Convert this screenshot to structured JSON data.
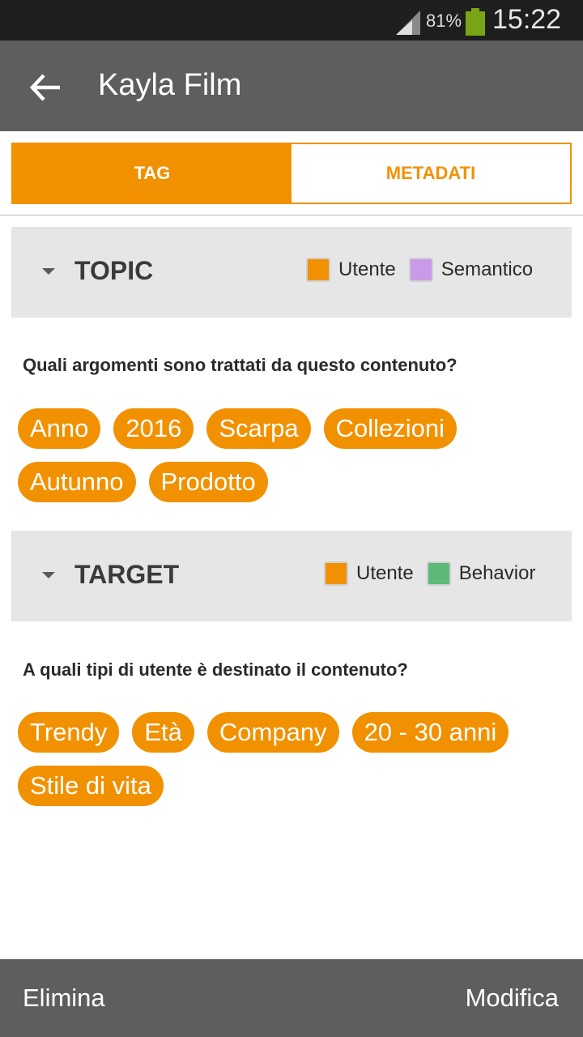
{
  "status_bar": {
    "battery_percent": "81%",
    "battery_level": 0.81,
    "time": "15:22",
    "signal_icon": "signal-icon",
    "battery_icon": "battery-icon"
  },
  "app_bar": {
    "title": "Kayla Film",
    "back_icon": "arrow-back-icon"
  },
  "tabs": [
    {
      "label": "TAG",
      "active": true
    },
    {
      "label": "METADATI",
      "active": false
    }
  ],
  "topic": {
    "title": "TOPIC",
    "legend": [
      {
        "label": "Utente",
        "color": "#f29100"
      },
      {
        "label": "Semantico",
        "color": "#c89ae8"
      }
    ],
    "question": "Quali argomenti sono trattati da questo contenuto?",
    "tags": [
      "Anno",
      "2016",
      "Scarpa",
      "Collezioni",
      "Autunno",
      "Prodotto"
    ]
  },
  "target": {
    "title": "TARGET",
    "legend": [
      {
        "label": "Utente",
        "color": "#f29100"
      },
      {
        "label": "Behavior",
        "color": "#5cb978"
      }
    ],
    "question": "A quali tipi di utente è destinato il contenuto?",
    "tags": [
      "Trendy",
      "Età",
      "Company",
      "20 - 30 anni",
      "Stile di vita"
    ]
  },
  "bottom_bar": {
    "delete_label": "Elimina",
    "edit_label": "Modifica"
  },
  "colors": {
    "accent": "#f29100",
    "app_bar": "#5e5e5e",
    "status_bar": "#1e1e1e",
    "section_bg": "#e6e6e6"
  }
}
